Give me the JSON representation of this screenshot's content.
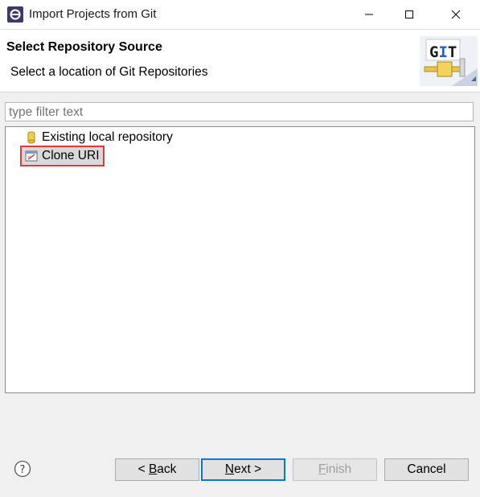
{
  "window": {
    "title": "Import Projects from Git"
  },
  "header": {
    "title": "Select Repository Source",
    "description": "Select a location of Git Repositories",
    "logo_text": "GIT"
  },
  "filter": {
    "placeholder": "type filter text"
  },
  "tree": {
    "items": [
      {
        "label": "Existing local repository",
        "icon": "repository-icon"
      },
      {
        "label": "Clone URI",
        "icon": "clone-uri-icon",
        "selected": true
      }
    ]
  },
  "buttons": {
    "back": {
      "mnemonic": "B",
      "rest": "ack",
      "prefix": "< "
    },
    "next": {
      "mnemonic": "N",
      "rest": "ext",
      "suffix": " >"
    },
    "finish": {
      "mnemonic": "F",
      "rest": "inish"
    },
    "cancel": {
      "label": "Cancel"
    }
  },
  "colors": {
    "selection_highlight": "#e0393e",
    "default_button_border": "#0078d7"
  }
}
